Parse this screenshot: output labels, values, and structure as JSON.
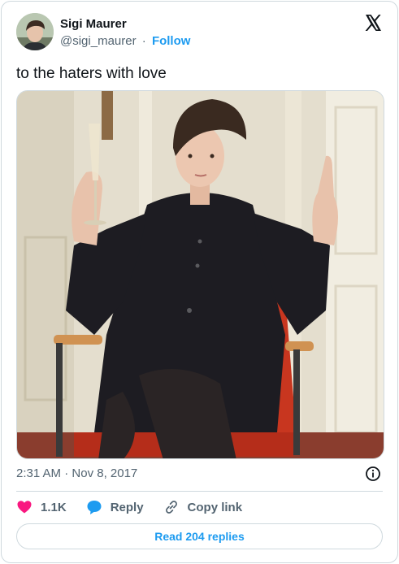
{
  "author": {
    "name": "Sigi Maurer",
    "handle": "@sigi_maurer",
    "separator": "·",
    "follow_label": "Follow"
  },
  "tweet": {
    "text": "to the haters with love",
    "time": "2:31 AM",
    "date_separator": "·",
    "date": "Nov 8, 2017"
  },
  "actions": {
    "likes": "1.1K",
    "reply_label": "Reply",
    "copy_link_label": "Copy link"
  },
  "read_replies_label": "Read 204 replies",
  "colors": {
    "accent": "#1d9bf0",
    "like": "#f91880",
    "muted": "#536471",
    "border": "#cfd9de"
  },
  "icons": [
    "x-logo-icon",
    "info-icon",
    "heart-icon",
    "reply-bubble-icon",
    "link-icon"
  ]
}
